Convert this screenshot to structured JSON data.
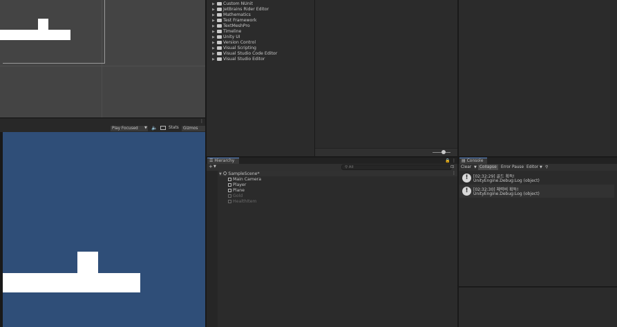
{
  "game_toolbar": {
    "play_mode": "Play Focused",
    "stats": "Stats",
    "gizmos": "Gizmos"
  },
  "project": {
    "folders": [
      "Custom NUnit",
      "JetBrains Rider Editor",
      "Mathematics",
      "Test Framework",
      "TextMeshPro",
      "Timeline",
      "Unity UI",
      "Version Control",
      "Visual Scripting",
      "Visual Studio Code Editor",
      "Visual Studio Editor"
    ]
  },
  "hierarchy": {
    "tab_label": "Hierarchy",
    "add_label": "+",
    "search_placeholder": "All",
    "scene_name": "SampleScene*",
    "objects": [
      {
        "name": "Main Camera",
        "active": true
      },
      {
        "name": "Player",
        "active": true
      },
      {
        "name": "Plane",
        "active": true
      },
      {
        "name": "Gold",
        "active": false
      },
      {
        "name": "HealthItem",
        "active": false
      }
    ]
  },
  "console": {
    "tab_label": "Console",
    "clear_label": "Clear",
    "collapse_label": "Collapse",
    "error_pause_label": "Error Pause",
    "editor_label": "Editor",
    "entries": [
      {
        "line1": "[02:32:29] 골드 획득!",
        "line2": "UnityEngine.Debug:Log (object)"
      },
      {
        "line1": "[02:32:30] 체력비 획득!",
        "line2": "UnityEngine.Debug:Log (object)"
      }
    ]
  },
  "colors": {
    "game_background": "#2f4e78",
    "scene_background": "#444444",
    "accent": "#5d8bd0"
  }
}
